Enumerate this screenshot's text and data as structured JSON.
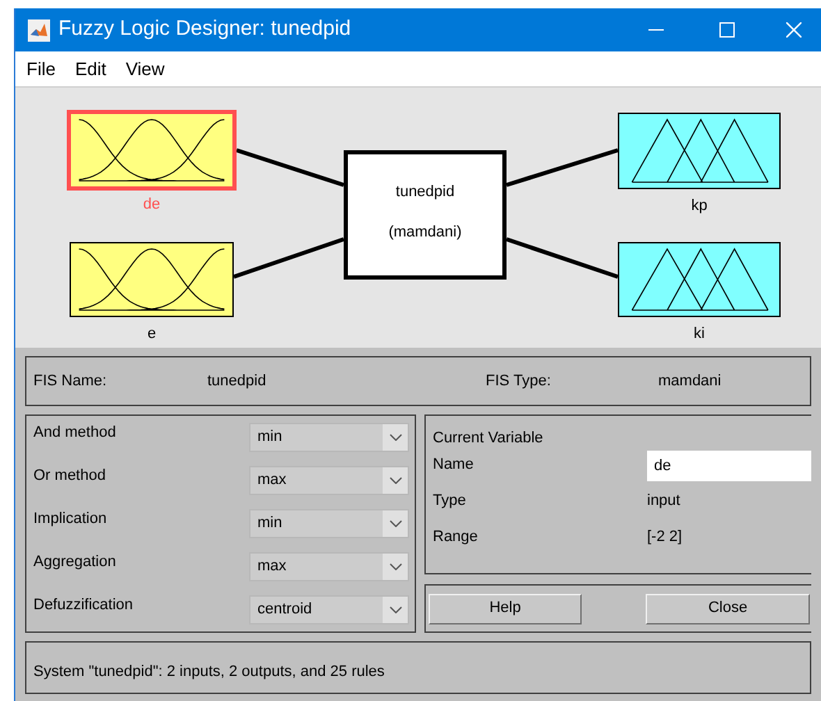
{
  "window": {
    "title": "Fuzzy Logic Designer: tunedpid"
  },
  "menu": [
    "File",
    "Edit",
    "View"
  ],
  "diagram": {
    "inputs": [
      {
        "name": "de",
        "selected": true
      },
      {
        "name": "e",
        "selected": false
      }
    ],
    "system": {
      "name": "tunedpid",
      "type": "(mamdani)"
    },
    "outputs": [
      {
        "name": "kp",
        "selected": false
      },
      {
        "name": "ki",
        "selected": false
      }
    ]
  },
  "fis": {
    "name_label": "FIS Name:",
    "name": "tunedpid",
    "type_label": "FIS Type:",
    "type": "mamdani"
  },
  "methods": [
    {
      "label": "And method",
      "value": "min"
    },
    {
      "label": "Or method",
      "value": "max"
    },
    {
      "label": "Implication",
      "value": "min"
    },
    {
      "label": "Aggregation",
      "value": "max"
    },
    {
      "label": "Defuzzification",
      "value": "centroid"
    }
  ],
  "current_variable": {
    "title": "Current Variable",
    "fields": [
      {
        "label": "Name",
        "value": "de",
        "kind": "input"
      },
      {
        "label": "Type",
        "value": "input",
        "kind": "text"
      },
      {
        "label": "Range",
        "value": "[-2 2]",
        "kind": "text"
      }
    ]
  },
  "buttons": [
    "Help",
    "Close"
  ],
  "status": "System \"tunedpid\": 2 inputs, 2 outputs, and 25 rules"
}
